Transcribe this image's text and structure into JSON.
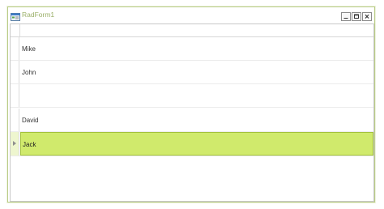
{
  "window": {
    "title": "RadForm1",
    "accent_color": "#b9cb86",
    "title_color": "#9aaf68",
    "icon": "app-form-icon",
    "controls": {
      "minimize_icon": "minimize-icon",
      "maximize_icon": "maximize-icon",
      "close_icon": "close-icon"
    }
  },
  "grid": {
    "selected_color": "#d0ea6c",
    "current_row_indicator_icon": "current-row-arrow-icon",
    "rows": [
      {
        "name": "Mike",
        "selected": false
      },
      {
        "name": "John",
        "selected": false
      },
      {
        "name": "",
        "selected": false
      },
      {
        "name": "David",
        "selected": false
      },
      {
        "name": "Jack",
        "selected": true
      }
    ]
  }
}
